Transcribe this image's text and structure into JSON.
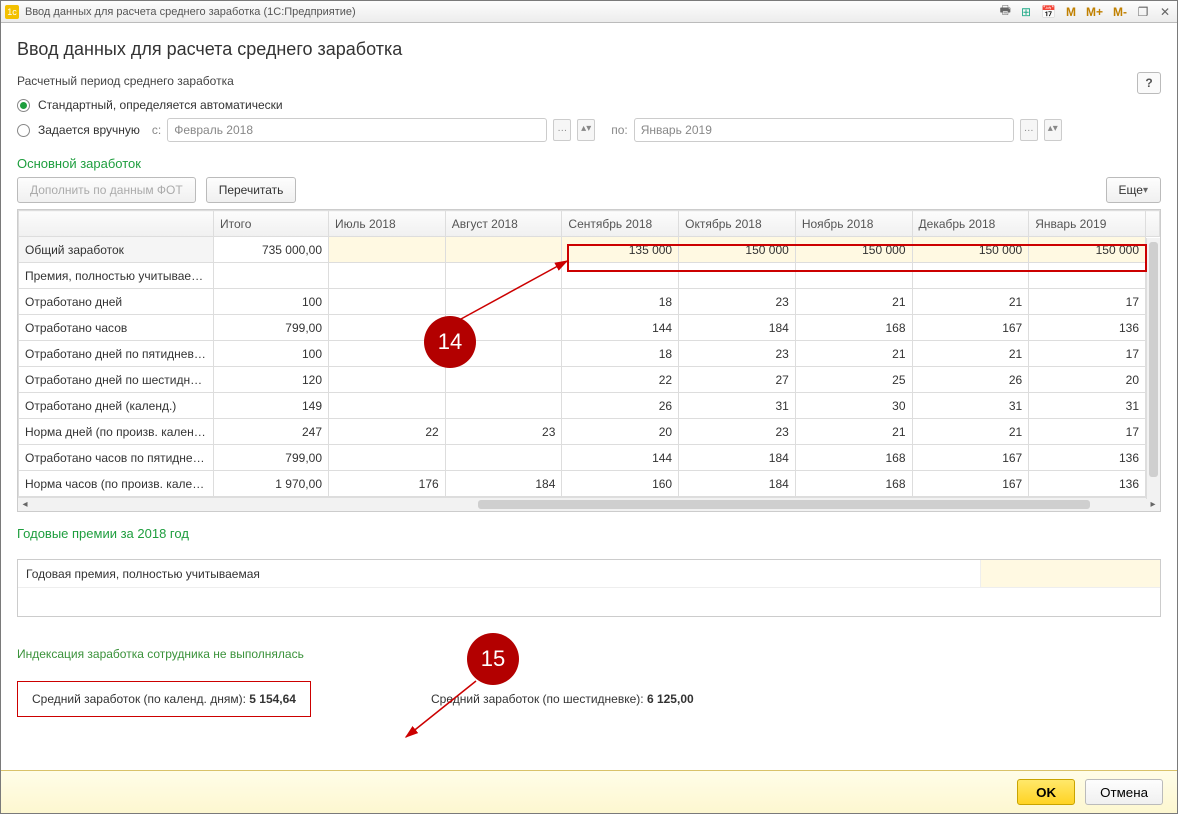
{
  "window": {
    "title": "Ввод данных для расчета среднего заработка  (1С:Предприятие)"
  },
  "page_title": "Ввод данных для расчета среднего заработка",
  "period": {
    "label": "Расчетный период среднего заработка",
    "radio_auto": "Стандартный, определяется автоматически",
    "radio_manual": "Задается вручную",
    "from_label": "с:",
    "from_value": "Февраль 2018",
    "to_label": "по:",
    "to_value": "Январь 2019"
  },
  "main_earnings": {
    "heading": "Основной заработок",
    "btn_fill": "Дополнить по данным ФОТ",
    "btn_recalc": "Перечитать",
    "btn_more": "Еще",
    "columns": [
      "",
      "Итого",
      "Июль 2018",
      "Август 2018",
      "Сентябрь 2018",
      "Октябрь 2018",
      "Ноябрь 2018",
      "Декабрь 2018",
      "Январь 2019"
    ],
    "rows": [
      {
        "label": "Общий заработок",
        "total": "735 000,00",
        "jul": "",
        "aug": "",
        "sep": "135 000",
        "oct": "150 000",
        "nov": "150 000",
        "dec": "150 000",
        "jan": "150 000",
        "hl": true,
        "sel": true
      },
      {
        "label": "Премия, полностью учитываемая",
        "total": "",
        "jul": "",
        "aug": "",
        "sep": "",
        "oct": "",
        "nov": "",
        "dec": "",
        "jan": ""
      },
      {
        "label": "Отработано дней",
        "total": "100",
        "jul": "",
        "aug": "",
        "sep": "18",
        "oct": "23",
        "nov": "21",
        "dec": "21",
        "jan": "17"
      },
      {
        "label": "Отработано часов",
        "total": "799,00",
        "jul": "",
        "aug": "",
        "sep": "144",
        "oct": "184",
        "nov": "168",
        "dec": "167",
        "jan": "136"
      },
      {
        "label": "Отработано дней по пятидневной...",
        "total": "100",
        "jul": "",
        "aug": "",
        "sep": "18",
        "oct": "23",
        "nov": "21",
        "dec": "21",
        "jan": "17"
      },
      {
        "label": "Отработано дней по шестидневн...",
        "total": "120",
        "jul": "",
        "aug": "",
        "sep": "22",
        "oct": "27",
        "nov": "25",
        "dec": "26",
        "jan": "20"
      },
      {
        "label": "Отработано дней (календ.)",
        "total": "149",
        "jul": "",
        "aug": "",
        "sep": "26",
        "oct": "31",
        "nov": "30",
        "dec": "31",
        "jan": "31"
      },
      {
        "label": "Норма дней (по произв. календа...",
        "total": "247",
        "jul": "22",
        "aug": "23",
        "sep": "20",
        "oct": "23",
        "nov": "21",
        "dec": "21",
        "jan": "17"
      },
      {
        "label": "Отработано часов по пятидневно...",
        "total": "799,00",
        "jul": "",
        "aug": "",
        "sep": "144",
        "oct": "184",
        "nov": "168",
        "dec": "167",
        "jan": "136"
      },
      {
        "label": "Норма часов (по произв. календа...",
        "total": "1 970,00",
        "jul": "176",
        "aug": "184",
        "sep": "160",
        "oct": "184",
        "nov": "168",
        "dec": "167",
        "jan": "136"
      }
    ]
  },
  "annual": {
    "heading": "Годовые премии за 2018 год",
    "row_label": "Годовая премия, полностью учитываемая"
  },
  "index_note": "Индексация заработка сотрудника не выполнялась",
  "summary": {
    "calendar_label": "Средний заработок (по календ. дням):",
    "calendar_value": "5 154,64",
    "sixday_label": "Средний заработок (по шестидневке):",
    "sixday_value": "6 125,00"
  },
  "footer": {
    "ok": "OK",
    "cancel": "Отмена"
  },
  "annotations": {
    "badge14": "14",
    "badge15": "15"
  }
}
